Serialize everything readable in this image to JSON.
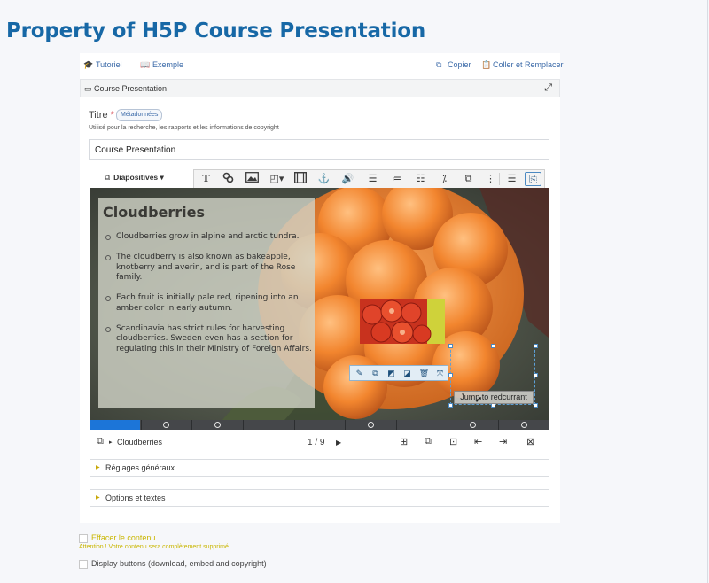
{
  "page": {
    "title": "Property of H5P Course Presentation"
  },
  "links": {
    "tutorial": "Tutoriel",
    "example": "Exemple",
    "copy": "Copier",
    "paste": "Coller et Remplacer"
  },
  "panel": {
    "title": "Course Presentation"
  },
  "title_field": {
    "label": "Titre",
    "required": "*",
    "metadata_button": "Métadonnées",
    "description": "Utilisé pour la recherche, les rapports et les informations de copyright",
    "value": "Course Presentation"
  },
  "toolbar": {
    "slides_label": "Diapositives",
    "tools": [
      "text-icon",
      "link-icon",
      "image-icon",
      "shapes-icon",
      "video-icon",
      "anchor-icon",
      "audio-icon",
      "fill-in-blanks-icon",
      "single-choice-icon",
      "multiple-choice-icon",
      "drag-text-icon",
      "drag-drop-icon",
      "more-icon",
      "table-icon",
      "paste-icon"
    ]
  },
  "slide": {
    "heading": "Cloudberries",
    "bullets": [
      "Cloudberries grow in alpine and arctic tundra.",
      "The cloudberry is also known as bakeapple, knotberry and averin, and is part of the Rose family.",
      "Each fruit is initially pale red, ripening into an amber color in early autumn.",
      "Scandinavia has strict rules for harvesting cloudberries. Sweden even has a section for regulating this in their Ministry of Foreign Affairs."
    ],
    "jump_button": "Jump to redcurrant",
    "colors": {
      "accent": "#1c75d8",
      "selection": "#5da0d6",
      "title": "#1768a6"
    }
  },
  "element_toolbar": [
    "edit-icon",
    "copy-icon",
    "bring-front-icon",
    "send-back-icon",
    "delete-icon",
    "resize-icon"
  ],
  "navigation": {
    "progress": 0.11,
    "slide_name": "Cloudberries",
    "page_current": "1",
    "page_separator": "/",
    "page_total": "9"
  },
  "sections": {
    "general": "Réglages généraux",
    "options": "Options et textes"
  },
  "options": {
    "delete_content": "Effacer le contenu",
    "delete_warning": "Attention ! Votre contenu sera complètement supprimé",
    "display_buttons": "Display buttons (download, embed and copyright)"
  }
}
